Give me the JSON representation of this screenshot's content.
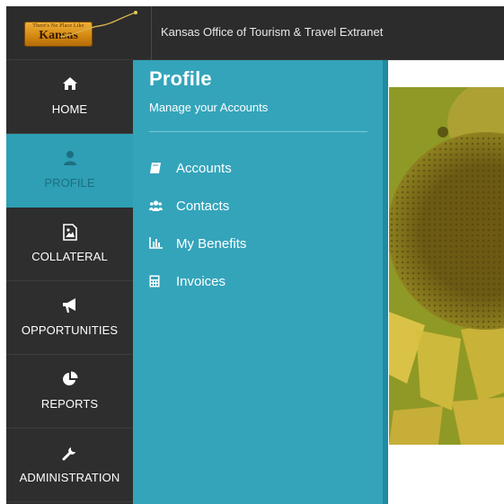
{
  "header": {
    "logo": {
      "small_text": "There's No Place Like",
      "main_text": "Kansas"
    },
    "title": "Kansas Office of Tourism & Travel Extranet"
  },
  "sidebar": {
    "items": [
      {
        "label": "HOME",
        "icon": "home-icon",
        "active": false
      },
      {
        "label": "PROFILE",
        "icon": "user-icon",
        "active": true
      },
      {
        "label": "COLLATERAL",
        "icon": "image-file-icon",
        "active": false
      },
      {
        "label": "OPPORTUNITIES",
        "icon": "megaphone-icon",
        "active": false
      },
      {
        "label": "REPORTS",
        "icon": "pie-chart-icon",
        "active": false
      },
      {
        "label": "ADMINISTRATION",
        "icon": "wrench-icon",
        "active": false
      }
    ]
  },
  "panel": {
    "title": "Profile",
    "subtitle": "Manage your Accounts",
    "items": [
      {
        "label": "Accounts",
        "icon": "book-icon"
      },
      {
        "label": "Contacts",
        "icon": "group-icon"
      },
      {
        "label": "My Benefits",
        "icon": "bar-chart-icon"
      },
      {
        "label": "Invoices",
        "icon": "calculator-icon"
      }
    ]
  },
  "hero": {
    "description_icon": "sunflower-image"
  },
  "colors": {
    "header_bg": "#2c2c2c",
    "sidebar_bg": "#2e2e2e",
    "accent": "#34a4bb",
    "accent_dark": "#1f8aa0",
    "active_text": "#1d6f80"
  }
}
